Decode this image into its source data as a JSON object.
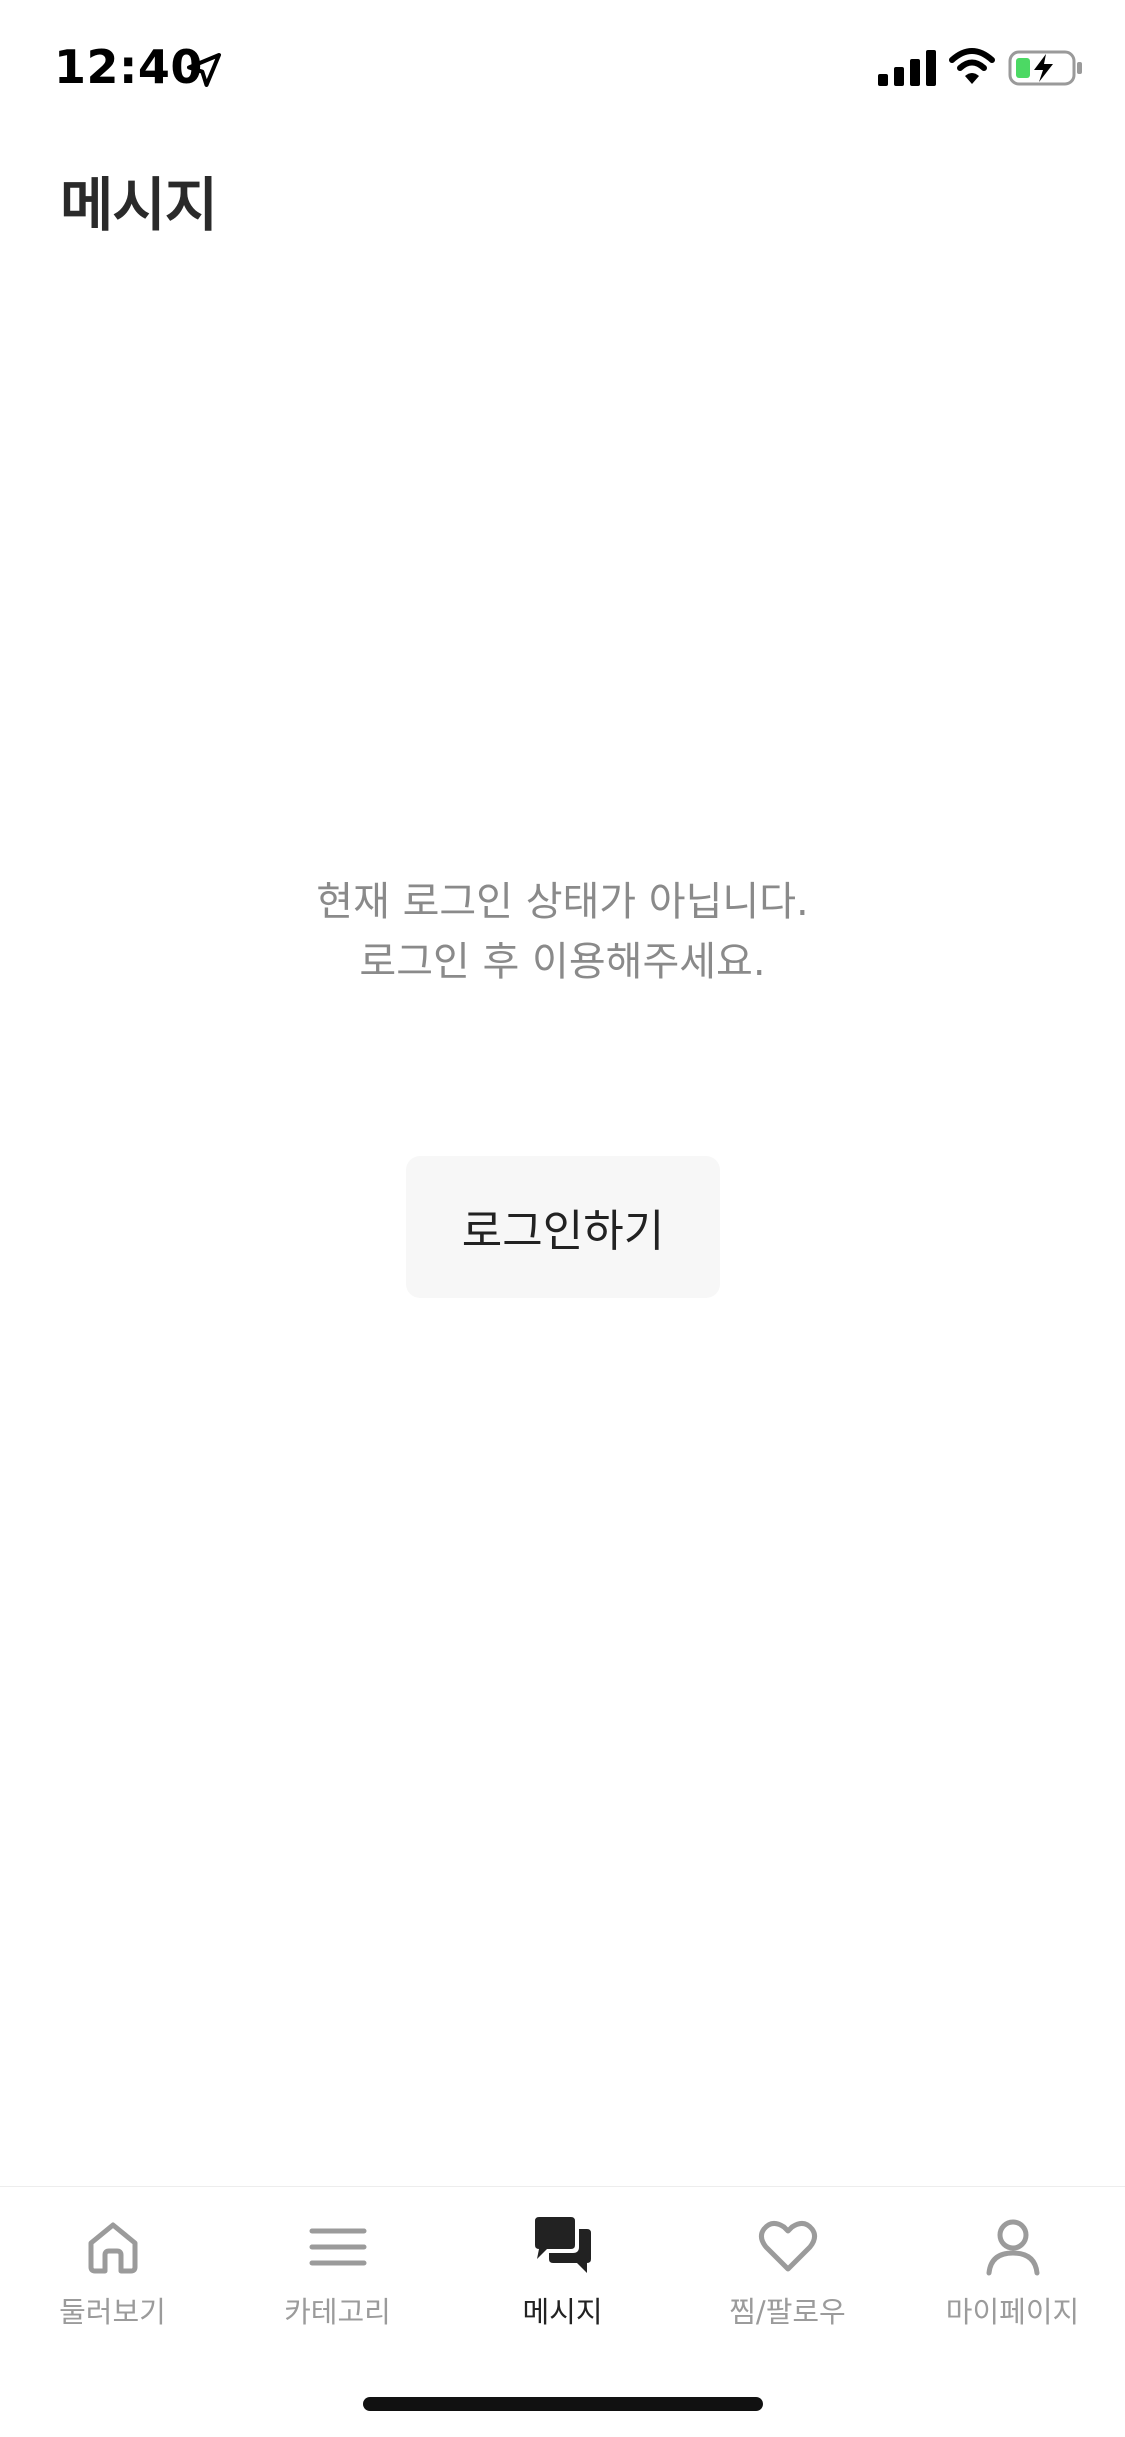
{
  "status_bar": {
    "time": "12:40",
    "icons": [
      "location-arrow-icon",
      "cellular-signal-icon",
      "wifi-icon",
      "battery-charging-icon"
    ],
    "battery_color": "#4cd964"
  },
  "header": {
    "title": "메시지"
  },
  "empty_state": {
    "line1": "현재 로그인 상태가 아닙니다.",
    "line2": "로그인 후 이용해주세요.",
    "login_button_label": "로그인하기"
  },
  "tab_bar": {
    "active_color": "#222222",
    "inactive_color": "#9b9b9b",
    "tabs": [
      {
        "label": "둘러보기",
        "icon": "home-icon",
        "active": false
      },
      {
        "label": "카테고리",
        "icon": "menu-icon",
        "active": false
      },
      {
        "label": "메시지",
        "icon": "chat-bubbles-icon",
        "active": true
      },
      {
        "label": "찜/팔로우",
        "icon": "heart-icon",
        "active": false
      },
      {
        "label": "마이페이지",
        "icon": "person-icon",
        "active": false
      }
    ]
  }
}
